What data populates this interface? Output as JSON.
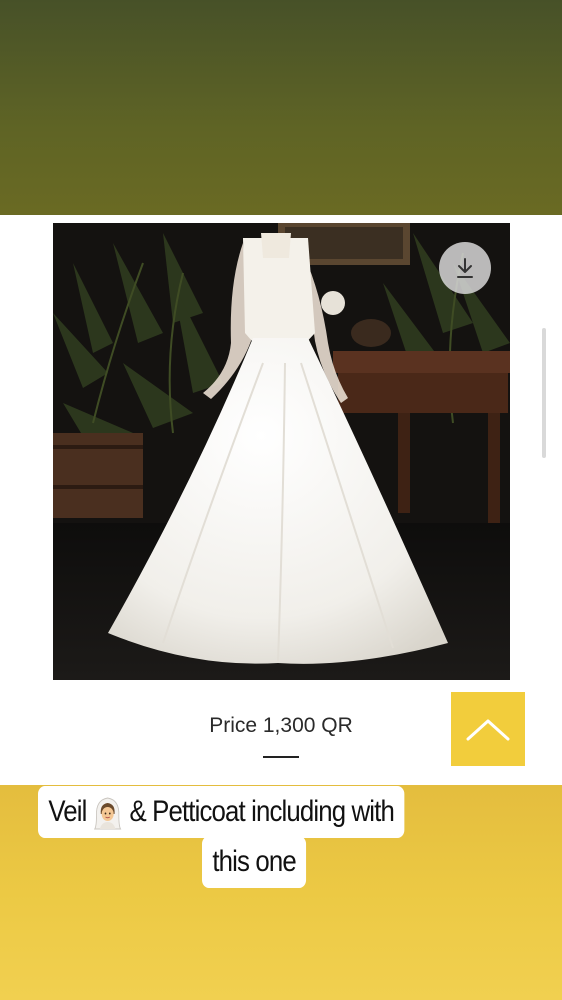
{
  "product": {
    "image_alt": "White ball gown wedding dress with lace sleeves",
    "price": "Price 1,300 QR"
  },
  "icons": {
    "download": "download-icon",
    "scroll_top": "chevron-up-icon",
    "veil": "woman-with-veil-emoji"
  },
  "caption": {
    "line1_before": "Veil",
    "line1_after": "& Petticoat  including with",
    "line2": "this one"
  },
  "colors": {
    "top_band": "#5f6425",
    "bottom_band": "#ecc944",
    "scroll_top_button": "#f2cd3c",
    "caption_background": "#ffffff"
  }
}
